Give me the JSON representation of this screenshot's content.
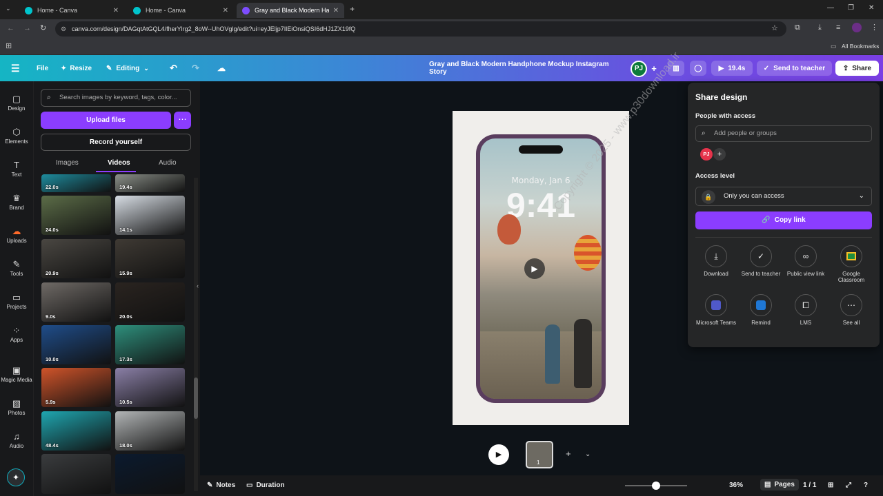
{
  "browser": {
    "tabs": [
      {
        "title": "Home - Canva"
      },
      {
        "title": "Home - Canva"
      },
      {
        "title": "Gray and Black Modern Handph"
      }
    ],
    "url": "canva.com/design/DAGqtAtGQL4/fherYlrg2_8oW--UhOVglg/edit?ui=eyJEljp7IlEiOnsiQSI6dHJ1ZX19fQ",
    "bookmarks_label": "All Bookmarks"
  },
  "header": {
    "file": "File",
    "resize": "Resize",
    "editing": "Editing",
    "design_title": "Gray and Black Modern Handphone Mockup Instagram Story",
    "avatar": "PJ",
    "play_duration": "19.4s",
    "send_to_teacher": "Send to teacher",
    "share": "Share"
  },
  "rail": {
    "items": [
      {
        "label": "Design"
      },
      {
        "label": "Elements"
      },
      {
        "label": "Text"
      },
      {
        "label": "Brand"
      },
      {
        "label": "Uploads"
      },
      {
        "label": "Tools"
      },
      {
        "label": "Projects"
      },
      {
        "label": "Apps"
      },
      {
        "label": "Magic Media"
      },
      {
        "label": "Photos"
      },
      {
        "label": "Audio"
      }
    ]
  },
  "panel": {
    "search_placeholder": "Search images by keyword, tags, color...",
    "upload": "Upload files",
    "record": "Record yourself",
    "tabs": [
      {
        "label": "Images"
      },
      {
        "label": "Videos"
      },
      {
        "label": "Audio"
      }
    ],
    "thumbs": [
      {
        "dur": "22.0s",
        "color": "#1e8c9e"
      },
      {
        "dur": "19.4s",
        "color": "#8a8f88"
      },
      {
        "dur": "24.0s",
        "color": "#5c6d48"
      },
      {
        "dur": "14.1s",
        "color": "#d7dde4"
      },
      {
        "dur": "20.9s",
        "color": "#4a4742"
      },
      {
        "dur": "15.9s",
        "color": "#3f3a34"
      },
      {
        "dur": "9.0s",
        "color": "#6f6a66"
      },
      {
        "dur": "20.0s",
        "color": "#2a2420"
      },
      {
        "dur": "10.0s",
        "color": "#1f4d8a"
      },
      {
        "dur": "17.3s",
        "color": "#2e8f7c"
      },
      {
        "dur": "5.9s",
        "color": "#d0542a"
      },
      {
        "dur": "10.5s",
        "color": "#8a7fa6"
      },
      {
        "dur": "48.4s",
        "color": "#1fa6b0"
      },
      {
        "dur": "18.0s",
        "color": "#b2b5b6"
      },
      {
        "dur": "",
        "color": "#3a3c3e"
      },
      {
        "dur": "",
        "color": "#0b1a2e"
      }
    ]
  },
  "canvas": {
    "date": "Monday, Jan 6",
    "time": "9:41",
    "watermark": "Copyright © 2025 - www.p30download.ir"
  },
  "share": {
    "title": "Share design",
    "people_label": "People with access",
    "people_placeholder": "Add people or groups",
    "avatar": "PJ",
    "access_label": "Access level",
    "access_value": "Only you can access",
    "copy_link": "Copy link",
    "options": [
      {
        "label": "Download",
        "icon": "download-icon"
      },
      {
        "label": "Send to teacher",
        "icon": "check-circle-icon"
      },
      {
        "label": "Public view link",
        "icon": "link-icon"
      },
      {
        "label": "Google Classroom",
        "icon": "google-classroom-icon"
      },
      {
        "label": "Microsoft Teams",
        "icon": "teams-icon"
      },
      {
        "label": "Remind",
        "icon": "remind-icon"
      },
      {
        "label": "LMS",
        "icon": "lms-icon"
      },
      {
        "label": "See all",
        "icon": "more-icon"
      }
    ]
  },
  "bottom": {
    "notes": "Notes",
    "duration": "Duration",
    "zoom": "36%",
    "pages": "Pages",
    "page_count": "1 / 1",
    "slide_number": "1"
  },
  "colors": {
    "accent": "#8b3dff",
    "brand_teal": "#15b5c4"
  }
}
